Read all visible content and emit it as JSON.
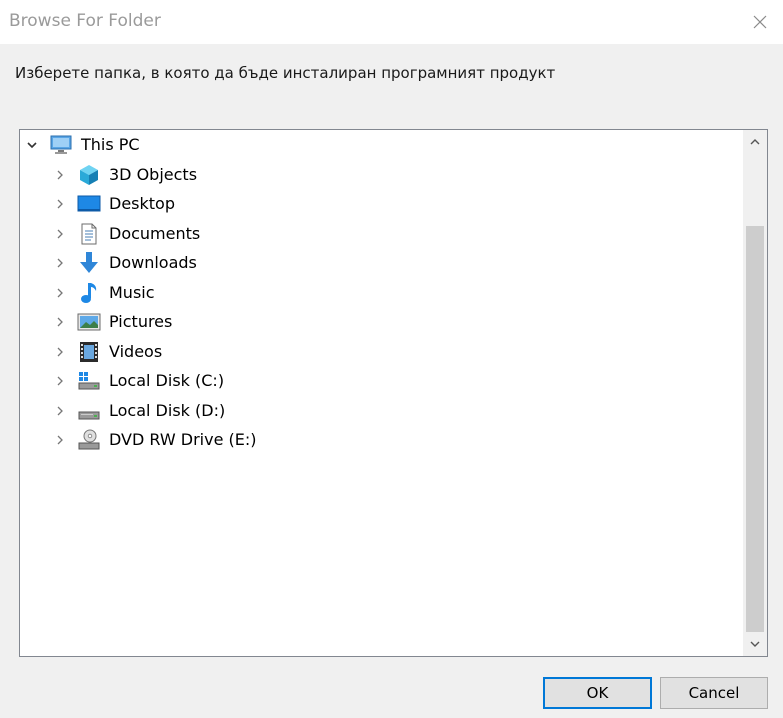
{
  "window": {
    "title": "Browse For Folder",
    "close_glyph": "close-icon"
  },
  "instruction": "Изберете папка, в която да бъде инсталиран програмният продукт",
  "tree": {
    "root": {
      "label": "This PC",
      "icon": "computer-icon",
      "expanded": true
    },
    "items": [
      {
        "label": "3D Objects",
        "icon": "3d-objects-icon"
      },
      {
        "label": "Desktop",
        "icon": "desktop-icon"
      },
      {
        "label": "Documents",
        "icon": "documents-icon"
      },
      {
        "label": "Downloads",
        "icon": "downloads-icon"
      },
      {
        "label": "Music",
        "icon": "music-icon"
      },
      {
        "label": "Pictures",
        "icon": "pictures-icon"
      },
      {
        "label": "Videos",
        "icon": "videos-icon"
      },
      {
        "label": "Local Disk (C:)",
        "icon": "windows-drive-icon"
      },
      {
        "label": "Local Disk (D:)",
        "icon": "drive-icon"
      },
      {
        "label": "DVD RW Drive (E:)",
        "icon": "dvd-drive-icon"
      }
    ]
  },
  "buttons": {
    "ok": "OK",
    "cancel": "Cancel"
  },
  "colors": {
    "accent": "#0078d7",
    "folder_blue": "#1e88e5"
  }
}
